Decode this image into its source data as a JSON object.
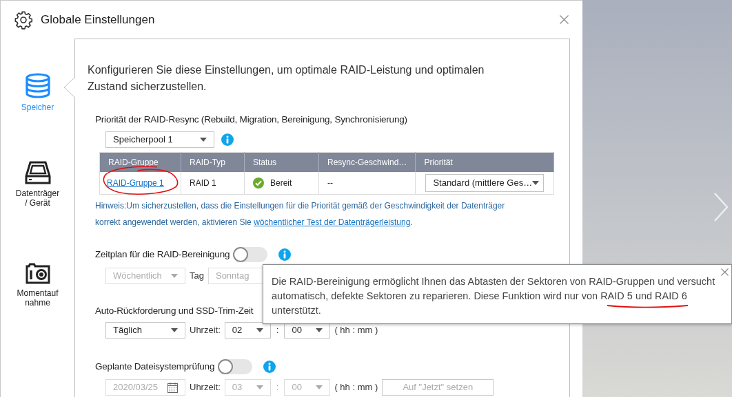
{
  "dialog": {
    "title": "Globale Einstellungen"
  },
  "sidebar": {
    "items": [
      {
        "kind": "storage",
        "label": "Speicher",
        "selected": true
      },
      {
        "kind": "disk",
        "label": "Datenträger / Gerät",
        "selected": false
      },
      {
        "kind": "snapshot",
        "label": "Momentaufnahme",
        "selected": false
      }
    ]
  },
  "intro": "Konfigurieren Sie diese Einstellungen, um optimale RAID-Leistung und optimalen Zustand sicherzustellen.",
  "resync": {
    "title": "Priorität der RAID-Resync (Rebuild, Migration, Bereinigung, Synchronisierung)",
    "pool": "Speicherpool 1",
    "table": {
      "columns": [
        "RAID-Gruppe",
        "RAID-Typ",
        "Status",
        "Resync-Geschwind…",
        "Priorität"
      ],
      "rows": [
        {
          "raid_group": "RAID-Gruppe 1",
          "raid_type": "RAID 1",
          "status": "Bereit",
          "resync_speed": "--",
          "priority": "Standard (mittlere Ges…",
          "circled": true
        }
      ]
    },
    "note": {
      "text": "Hinweis:Um sicherzustellen, dass die Einstellungen für die Priorität gemäß der Geschwindigkeit der Datenträger korrekt angewendet werden, aktivieren Sie ",
      "link": "wöchentlicher Test der Datenträgerleistung",
      "end": "."
    }
  },
  "scrub": {
    "title": "Zeitplan für die RAID-Bereinigung",
    "enabled": false,
    "frequency": "Wöchentlich",
    "day_label": "Tag",
    "day": "Sonntag"
  },
  "trim": {
    "title": "Auto-Rückforderung und SSD-Trim-Zeit",
    "frequency": "Täglich",
    "time_label": "Uhrzeit:",
    "hour": "02",
    "separator": ":",
    "minute": "00",
    "format": "( hh : mm )"
  },
  "fscheck": {
    "title": "Geplante Dateisystemprüfung",
    "enabled": false,
    "date": "2020/03/25",
    "time_label": "Uhrzeit:",
    "hour": "03",
    "separator": ":",
    "minute": "00",
    "format": "( hh : mm )",
    "now_button": "Auf \"Jetzt\" setzen"
  },
  "tooltip": {
    "text": "Die RAID-Bereinigung ermöglicht Ihnen das Abtasten der Sektoren von RAID-Gruppen und versucht automatisch, defekte Sektoren zu reparieren. Diese Funktion wird nur von RAID 5 und RAID 6 unterstützt.",
    "underlined": true
  }
}
